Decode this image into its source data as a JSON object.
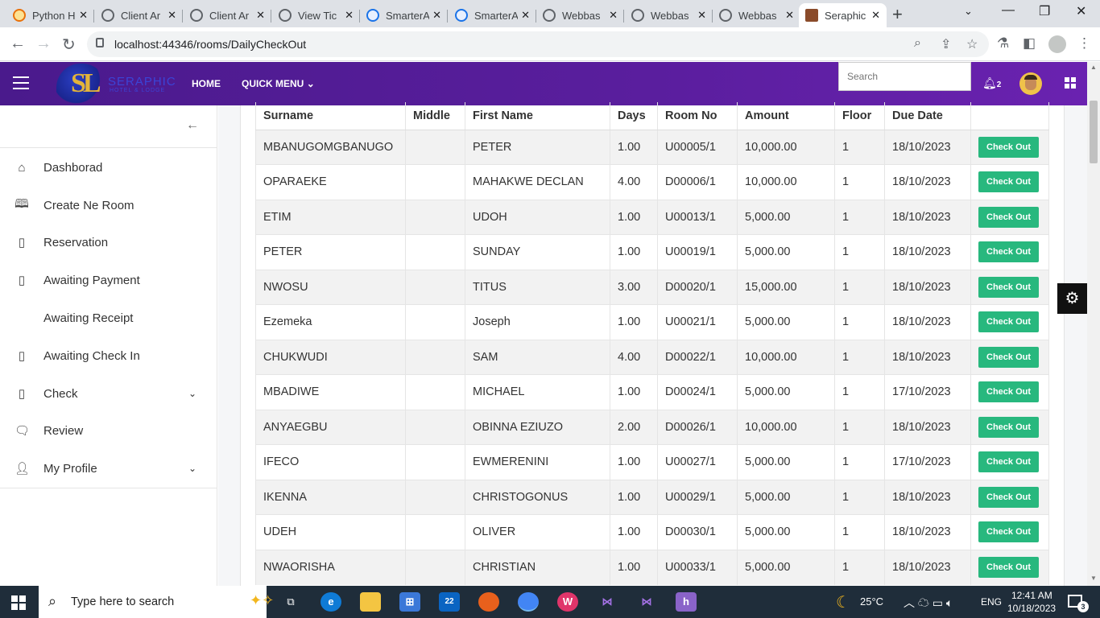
{
  "browser": {
    "tabs": [
      {
        "label": "Python H",
        "icon": "python-icon"
      },
      {
        "label": "Client Ar",
        "icon": "globe-icon"
      },
      {
        "label": "Client Ar",
        "icon": "globe-icon"
      },
      {
        "label": "View Tic",
        "icon": "globe-icon"
      },
      {
        "label": "SmarterA",
        "icon": "smarterasp-icon"
      },
      {
        "label": "SmarterA",
        "icon": "smarterasp-icon"
      },
      {
        "label": "Webbas",
        "icon": "globe-icon"
      },
      {
        "label": "Webbas",
        "icon": "globe-icon"
      },
      {
        "label": "Webbas",
        "icon": "globe-icon"
      },
      {
        "label": "Seraphic",
        "icon": "hotel-icon"
      }
    ],
    "url": "localhost:44346/rooms/DailyCheckOut"
  },
  "header": {
    "logo_text": "SERAPHIC",
    "logo_sub": "HOTEL & LODGE",
    "nav": [
      "HOME",
      "QUICK MENU"
    ],
    "search_placeholder": "Search",
    "notification_count": "2"
  },
  "sidebar": {
    "items": [
      {
        "label": "Dashborad",
        "icon": "home-icon"
      },
      {
        "label": "Create Ne Room",
        "icon": "book-icon"
      },
      {
        "label": "Reservation",
        "icon": "box-icon"
      },
      {
        "label": "Awaiting Payment",
        "icon": "box-icon"
      },
      {
        "label": "Awaiting Receipt",
        "icon": ""
      },
      {
        "label": "Awaiting Check In",
        "icon": "box-icon"
      },
      {
        "label": "Check",
        "icon": "box-icon"
      },
      {
        "label": "Review",
        "icon": "review-icon"
      },
      {
        "label": "My Profile",
        "icon": "user-icon"
      }
    ]
  },
  "table": {
    "columns": [
      "Surname",
      "Middle",
      "First Name",
      "Days",
      "Room No",
      "Amount",
      "Floor",
      "Due Date",
      ""
    ],
    "button_label": "Check Out",
    "rows": [
      [
        "MBANUGOMGBANUGO",
        "",
        "PETER",
        "1.00",
        "U00005/1",
        "10,000.00",
        "1",
        "18/10/2023"
      ],
      [
        "OPARAEKE",
        "",
        "MAHAKWE DECLAN",
        "4.00",
        "D00006/1",
        "10,000.00",
        "1",
        "18/10/2023"
      ],
      [
        "ETIM",
        "",
        "UDOH",
        "1.00",
        "U00013/1",
        "5,000.00",
        "1",
        "18/10/2023"
      ],
      [
        "PETER",
        "",
        "SUNDAY",
        "1.00",
        "U00019/1",
        "5,000.00",
        "1",
        "18/10/2023"
      ],
      [
        "NWOSU",
        "",
        "TITUS",
        "3.00",
        "D00020/1",
        "15,000.00",
        "1",
        "18/10/2023"
      ],
      [
        "Ezemeka",
        "",
        "Joseph",
        "1.00",
        "U00021/1",
        "5,000.00",
        "1",
        "18/10/2023"
      ],
      [
        "CHUKWUDI",
        "",
        "SAM",
        "4.00",
        "D00022/1",
        "10,000.00",
        "1",
        "18/10/2023"
      ],
      [
        "MBADIWE",
        "",
        "MICHAEL",
        "1.00",
        "D00024/1",
        "5,000.00",
        "1",
        "17/10/2023"
      ],
      [
        "ANYAEGBU",
        "",
        "OBINNA EZIUZO",
        "2.00",
        "D00026/1",
        "10,000.00",
        "1",
        "18/10/2023"
      ],
      [
        "IFECO",
        "",
        "EWMERENINI",
        "1.00",
        "U00027/1",
        "5,000.00",
        "1",
        "17/10/2023"
      ],
      [
        "IKENNA",
        "",
        "CHRISTOGONUS",
        "1.00",
        "U00029/1",
        "5,000.00",
        "1",
        "18/10/2023"
      ],
      [
        "UDEH",
        "",
        "OLIVER",
        "1.00",
        "D00030/1",
        "5,000.00",
        "1",
        "18/10/2023"
      ],
      [
        "NWAORISHA",
        "",
        "CHRISTIAN",
        "1.00",
        "U00033/1",
        "5,000.00",
        "1",
        "18/10/2023"
      ]
    ]
  },
  "taskbar": {
    "search_text": "Type here to search",
    "mail_badge": "22",
    "temperature": "25°C",
    "language": "ENG",
    "time": "12:41 AM",
    "date": "10/18/2023",
    "notification_count": "3"
  },
  "colors": {
    "header": "#5a1e9e",
    "checkout_button": "#28b87e",
    "logo_gold": "#e3b43a"
  }
}
